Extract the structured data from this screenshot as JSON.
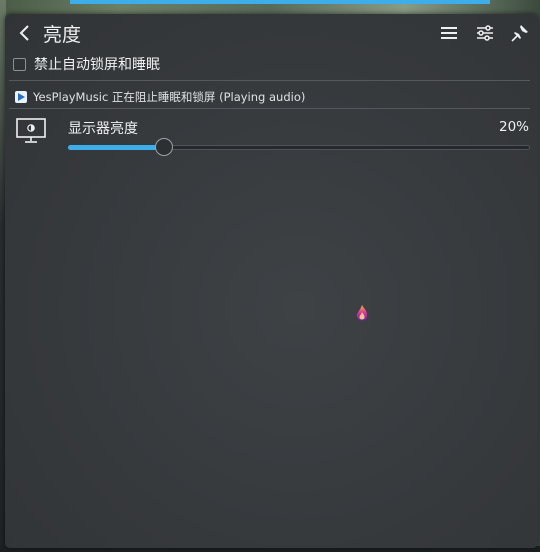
{
  "header": {
    "title": "亮度",
    "back_icon": "chevron-left-icon",
    "menu_icon": "hamburger-icon",
    "config_icon": "sliders-icon",
    "pin_icon": "pin-icon"
  },
  "inhibit": {
    "label": "禁止自动锁屏和睡眠",
    "checked": false
  },
  "blocking": {
    "app_name": "YesPlayMusic",
    "message": "正在阻止睡眠和锁屏 (Playing audio)",
    "full_text": "YesPlayMusic 正在阻止睡眠和锁屏 (Playing audio)"
  },
  "display": {
    "label": "显示器亮度",
    "percent_text": "20%",
    "brightness_fraction": 0.2,
    "icon": "monitor-brightness-icon"
  },
  "colors": {
    "accent": "#3daee9",
    "background": "#36393c",
    "text": "#eff0f1"
  }
}
